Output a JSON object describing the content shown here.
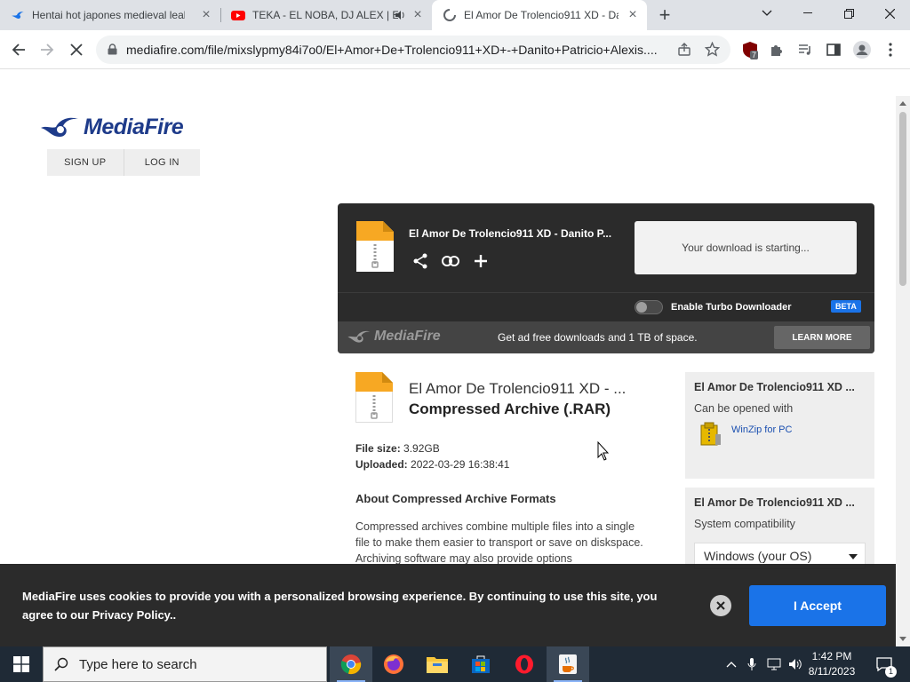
{
  "browser": {
    "tabs": [
      {
        "title": "Hentai hot japones medieval leal",
        "favicon": "mediafire-icon",
        "active": false
      },
      {
        "title": "TEKA - EL NOBA, DJ ALEX | E",
        "favicon": "youtube-icon",
        "active": false,
        "audio": true
      },
      {
        "title": "El Amor De Trolencio911 XD - Da",
        "favicon": "loading-icon",
        "active": true
      }
    ],
    "url": "mediafire.com/file/mixslypmy84i7o0/El+Amor+De+Trolencio911+XD+-+Danito+Patricio+Alexis....",
    "extension_badge": "7"
  },
  "page": {
    "header": {
      "logo_text": "MediaFire",
      "signup": "SIGN UP",
      "login": "LOG IN"
    },
    "download_card": {
      "filename": "El Amor De Trolencio911 XD - Danito P...",
      "status": "Your download is starting...",
      "turbo_label": "Enable Turbo Downloader",
      "beta": "BETA",
      "promo_logo": "MediaFire",
      "promo_text": "Get ad free downloads and 1 TB of space.",
      "learn_more": "LEARN MORE"
    },
    "file_info": {
      "name": "El Amor De Trolencio911 XD - ...",
      "type": "Compressed Archive (.RAR)",
      "size_label": "File size:",
      "size_value": "3.92GB",
      "uploaded_label": "Uploaded:",
      "uploaded_value": "2022-03-29 16:38:41",
      "about_heading": "About Compressed Archive Formats",
      "about_text": "Compressed archives combine multiple files into a single file to make them easier to transport or save on diskspace. Archiving software may also provide options"
    },
    "sidebar": {
      "card1_title": "El Amor De Trolencio911 XD ...",
      "card1_sub": "Can be opened with",
      "winzip": "WinZip for PC",
      "card2_title": "El Amor De Trolencio911 XD ...",
      "card2_sub": "System compatibility",
      "os_selected": "Windows (your OS)"
    },
    "cookie": {
      "message": "MediaFire uses cookies to provide you with a personalized browsing experience. By continuing to use this site, you agree to our Privacy Policy..",
      "accept": "I Accept"
    }
  },
  "taskbar": {
    "search_placeholder": "Type here to search",
    "time": "1:42 PM",
    "date": "8/11/2023",
    "notification_count": "1"
  },
  "colors": {
    "mediafire_blue": "#1e3b8a",
    "accept_blue": "#1a73e8",
    "card_dark": "#2b2b2b",
    "file_icon_orange": "#f7a823"
  }
}
